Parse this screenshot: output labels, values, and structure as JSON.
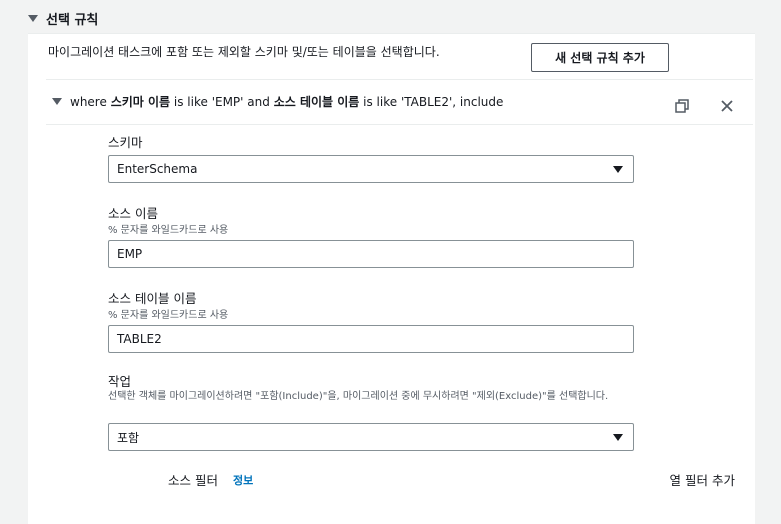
{
  "section": {
    "title": "선택 규칙"
  },
  "description": "마이그레이션 태스크에 포함 또는 제외할 스키마 및/또는 테이블을 선택합니다.",
  "add_rule_button": "새 선택 규칙 추가",
  "rule": {
    "where": "where",
    "schema_name": "스키마 이름",
    "is_like_1": "is like 'EMP' and",
    "source_table_name": "소스 테이블 이름",
    "is_like_2": "is like 'TABLE2', include"
  },
  "fields": {
    "schema": {
      "label": "스키마",
      "value": "EnterSchema"
    },
    "source_name": {
      "label": "소스 이름",
      "hint": "% 문자를 와일드카드로 사용",
      "value": "EMP"
    },
    "source_table": {
      "label": "소스 테이블 이름",
      "hint": "% 문자를 와일드카드로 사용",
      "value": "TABLE2"
    },
    "action": {
      "label": "작업",
      "hint": "선택한 객체를 마이그레이션하려면 \"포함(Include)\"을, 마이그레이션 중에 무시하려면 \"제외(Exclude)\"를 선택합니다.",
      "value": "포함"
    }
  },
  "source_filter": {
    "title": "소스 필터",
    "info": "정보",
    "add_column_filter": "열 필터 추가"
  },
  "icons": [
    "caret-down-icon",
    "copy-icon",
    "close-icon"
  ]
}
